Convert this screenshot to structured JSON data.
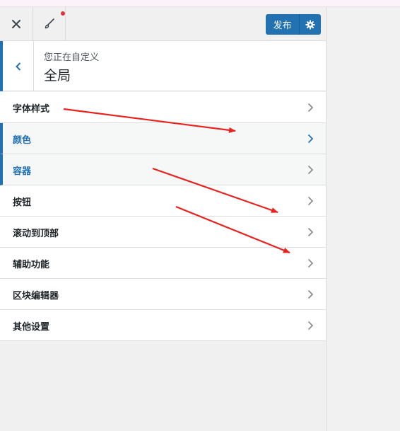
{
  "header": {
    "close_icon": "close-icon",
    "brush_icon": "paintbrush-icon",
    "publish_label": "发布",
    "gear_icon": "gear-icon",
    "accent": "#2271b1",
    "notify_color": "#d63638"
  },
  "section": {
    "breadcrumb": "您正在自定义",
    "title": "全局",
    "back_icon": "chevron-left-icon"
  },
  "menu": {
    "items": [
      {
        "label": "字体样式"
      },
      {
        "label": "颜色"
      },
      {
        "label": "容器"
      },
      {
        "label": "按钮"
      },
      {
        "label": "滚动到顶部"
      },
      {
        "label": "辅助功能"
      },
      {
        "label": "区块编辑器"
      },
      {
        "label": "其他设置"
      }
    ]
  },
  "annotation_color": "#e8231f"
}
